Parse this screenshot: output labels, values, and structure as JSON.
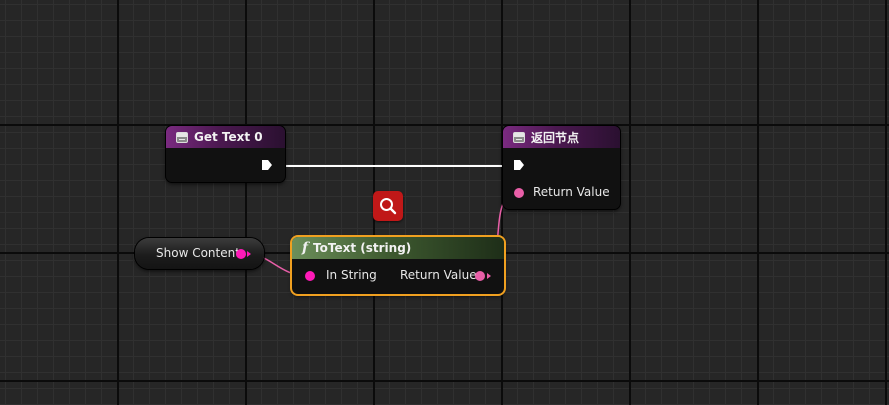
{
  "nodes": {
    "get_text": {
      "title": "Get Text 0",
      "icon": "event-node-icon"
    },
    "return_node": {
      "title": "返回节点",
      "icon": "event-node-icon",
      "pin_return_value": "Return Value"
    },
    "show_content": {
      "label": "Show Content"
    },
    "to_text": {
      "title": "ToText (string)",
      "icon": "function-icon",
      "pin_in_string": "In String",
      "pin_return_value": "Return Value"
    }
  },
  "toolbar": {
    "search_icon": "magnifier-search-icon"
  },
  "colors": {
    "graph_background": "#262626",
    "event_header": "#7a2a80",
    "function_header": "#6c8f5a",
    "string_pin": "#e95fa8",
    "selection_outline": "#f0a020",
    "search_button": "#c01818",
    "exec_wire": "#ffffff"
  }
}
